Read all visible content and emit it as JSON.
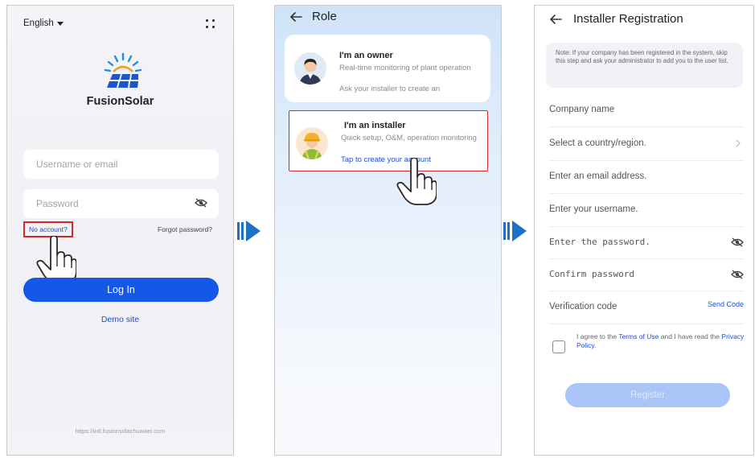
{
  "login": {
    "language": "English",
    "app_name": "FusionSolar",
    "username_placeholder": "Username or email",
    "password_placeholder": "Password",
    "no_account": "No account?",
    "forgot_password": "Forgot password?",
    "login_button": "Log In",
    "demo_site": "Demo site",
    "url": "https://intl.fusionsolachuawei.com"
  },
  "role": {
    "title": "Role",
    "owner": {
      "title": "I'm an owner",
      "desc": "Real-time monitoring of plant operation",
      "hint": "Ask your installer to create an"
    },
    "installer": {
      "title": "I'm an installer",
      "desc": "Quick setup, O&M, operation monitoring",
      "link": "Tap to create your account"
    }
  },
  "registration": {
    "title": "Installer Registration",
    "note": "Note: If your company has been registered in the system, skip this step and ask your administrator to add you to the user list.",
    "fields": [
      {
        "label": "Company name",
        "kind": "text"
      },
      {
        "label": "Select a country/region.",
        "kind": "select"
      },
      {
        "label": "Enter an email address.",
        "kind": "text"
      },
      {
        "label": "Enter your username.",
        "kind": "text"
      },
      {
        "label": "Enter the password.",
        "kind": "password"
      },
      {
        "label": "Confirm password",
        "kind": "password"
      },
      {
        "label": "Verification code",
        "kind": "code"
      }
    ],
    "send_code": "Send Code",
    "agree_prefix": "I agree to the",
    "terms": "Terms of Use",
    "agree_middle": "and I have read the",
    "privacy": "Privacy Policy.",
    "register_button": "Register"
  },
  "colors": {
    "primary": "#1558e8",
    "link": "#1e4fd0",
    "highlight_box": "#d02a2a",
    "flow_arrow": "#1f6fc4",
    "register_disabled": "#a9c5f8"
  },
  "icons": [
    "caret-down-icon",
    "grid-menu-icon",
    "solar-logo-icon",
    "eye-slash-icon",
    "hand-pointer-icon",
    "back-arrow-icon",
    "owner-avatar-icon",
    "installer-avatar-icon",
    "chevron-right-icon",
    "flow-arrow-icon"
  ]
}
